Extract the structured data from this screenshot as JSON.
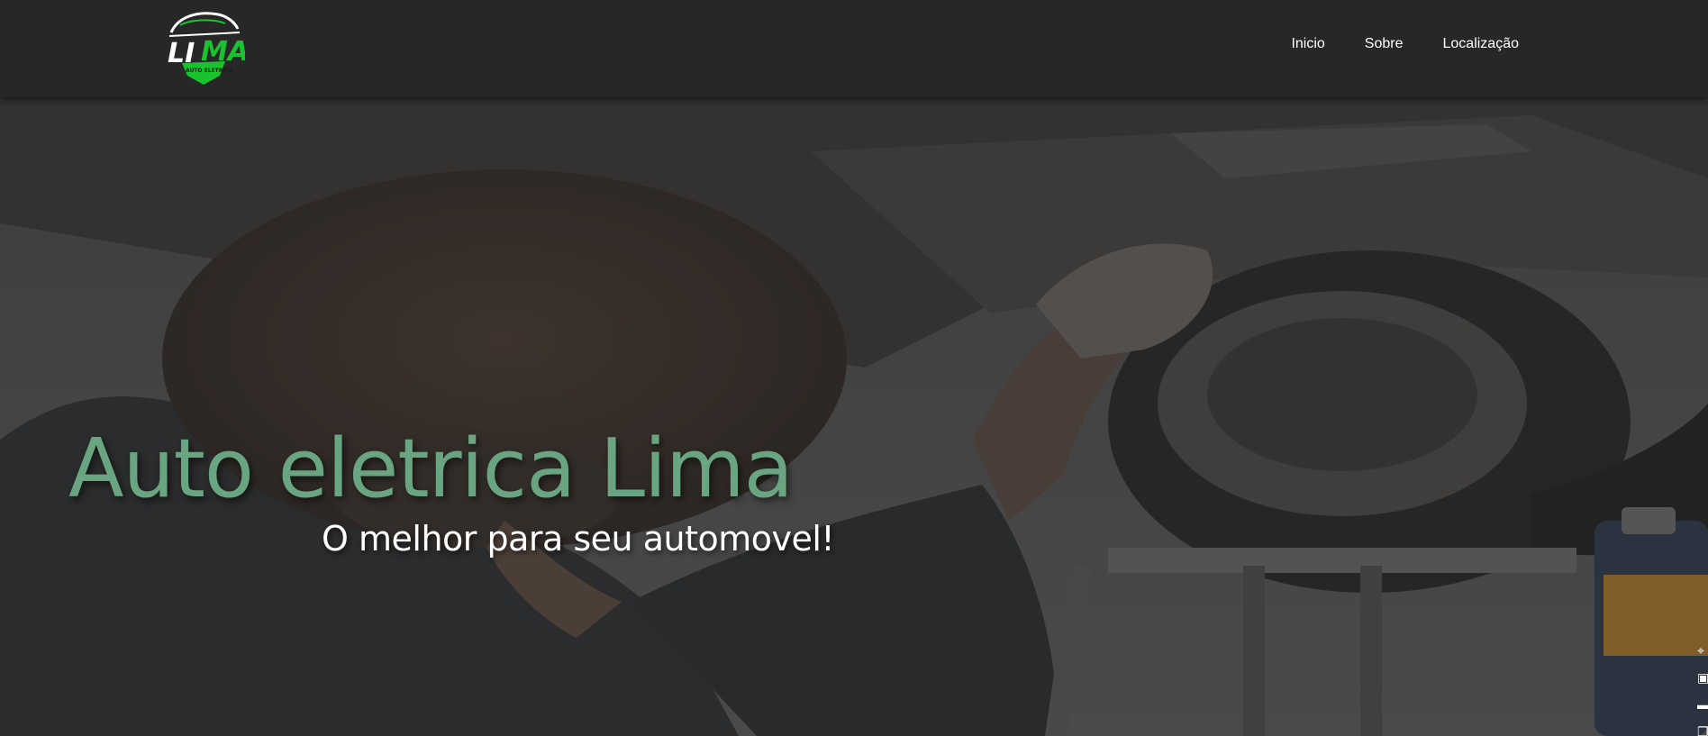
{
  "brand": {
    "logo_text_left": "LI",
    "logo_text_right": "MA",
    "logo_tagline": "AUTO ELETRICA",
    "accent_color": "#19c330"
  },
  "nav": {
    "items": [
      {
        "label": "Inicio"
      },
      {
        "label": "Sobre"
      },
      {
        "label": "Localização"
      }
    ]
  },
  "hero": {
    "title": "Auto eletrica Lima",
    "subtitle": "O melhor para seu automovel!",
    "title_color": "#6aa581"
  },
  "side_tools": {
    "icons": [
      "pin-icon",
      "camera-icon",
      "message-icon",
      "copy-icon",
      "puzzle-icon"
    ]
  }
}
